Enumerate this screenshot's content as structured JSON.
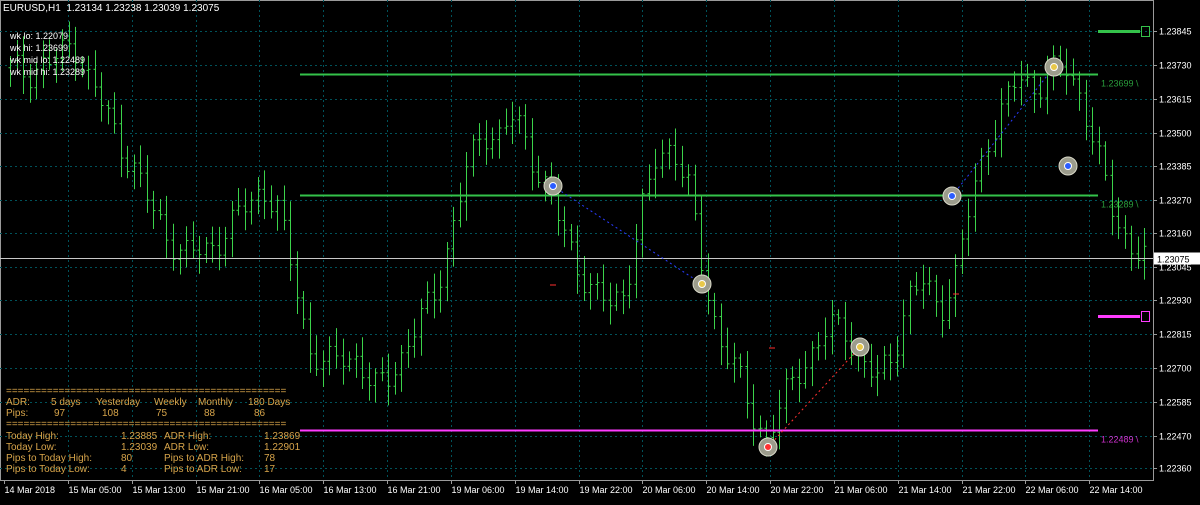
{
  "symbol_header": "EURUSD,H1  1.23134 1.23238 1.23039 1.23075",
  "week_levels": [
    "wk lo: 1.22079",
    "wk hi: 1.23699",
    "wk mid lo: 1.22489",
    "wk mid hi: 1.23289"
  ],
  "colors": {
    "background": "#000000",
    "grid": "#00525a",
    "candle": "#3bd34a",
    "level_line": "#34c24a",
    "magenta_line": "#ff3cff",
    "adr_text": "#d7a44a",
    "current_price_tag": "#ffffff"
  },
  "right_level_labels": [
    {
      "text": "1.23699 \\",
      "price": 1.23699,
      "color": "#34c24a"
    },
    {
      "text": "1.23289 \\",
      "price": 1.23289,
      "color": "#34c24a"
    },
    {
      "text": "1.22489 \\",
      "price": 1.22489,
      "color": "#ff3cff"
    }
  ],
  "current_price": "1.23075",
  "adr_panel": {
    "separator": "================================================",
    "row1": [
      "ADR:",
      "5 days",
      "Yesterday",
      "Weekly",
      "Monthly",
      "180 Days"
    ],
    "row2": [
      "Pips:",
      "97",
      "108",
      "75",
      "88",
      "86"
    ],
    "stats": [
      [
        "Today High:",
        "1.23885",
        "ADR High:",
        "1.23869"
      ],
      [
        "Today Low:",
        "1.23039",
        "ADR Low:",
        "1.22901"
      ],
      [
        "Pips to Today High:",
        "80",
        "Pips to ADR High:",
        "78"
      ],
      [
        "Pips to Today Low:",
        "4",
        "Pips to ADR Low:",
        "17"
      ]
    ]
  },
  "chart_data": {
    "type": "candlestick",
    "symbol": "EURUSD",
    "timeframe": "H1",
    "y_ticks": [
      "1.23845",
      "1.23730",
      "1.23615",
      "1.23500",
      "1.23385",
      "1.23270",
      "1.23160",
      "1.23045",
      "1.22930",
      "1.22815",
      "1.22700",
      "1.22585",
      "1.22470",
      "1.22360"
    ],
    "x_ticks": [
      "14 Mar 2018",
      "15 Mar 05:00",
      "15 Mar 13:00",
      "15 Mar 21:00",
      "16 Mar 05:00",
      "16 Mar 13:00",
      "16 Mar 21:00",
      "19 Mar 06:00",
      "19 Mar 14:00",
      "19 Mar 22:00",
      "20 Mar 06:00",
      "20 Mar 14:00",
      "20 Mar 22:00",
      "21 Mar 06:00",
      "21 Mar 14:00",
      "21 Mar 22:00",
      "22 Mar 06:00",
      "22 Mar 14:00"
    ],
    "ylim": [
      1.2232,
      1.2395
    ],
    "close_path": [
      1.2372,
      1.237,
      1.2373,
      1.2375,
      1.2381,
      1.2368,
      1.2358,
      1.2346,
      1.2336,
      1.2324,
      1.2315,
      1.2308,
      1.231,
      1.2312,
      1.2318,
      1.2326,
      1.2331,
      1.2323,
      1.2302,
      1.2276,
      1.227,
      1.2275,
      1.2273,
      1.2262,
      1.2268,
      1.2275,
      1.2286,
      1.2297,
      1.2315,
      1.2338,
      1.2351,
      1.2348,
      1.2356,
      1.2343,
      1.2331,
      1.2318,
      1.2305,
      1.2295,
      1.2292,
      1.2296,
      1.2321,
      1.2341,
      1.2346,
      1.2332,
      1.2301,
      1.228,
      1.227,
      1.2255,
      1.2246,
      1.2258,
      1.2269,
      1.2276,
      1.2284,
      1.2283,
      1.2272,
      1.2266,
      1.2275,
      1.2294,
      1.2299,
      1.229,
      1.2301,
      1.2327,
      1.2347,
      1.2358,
      1.2369,
      1.2365,
      1.237,
      1.2372,
      1.2362,
      1.2342,
      1.2323,
      1.2312,
      1.23075
    ],
    "horizontal_levels": [
      1.23699,
      1.23289,
      1.22489
    ]
  }
}
